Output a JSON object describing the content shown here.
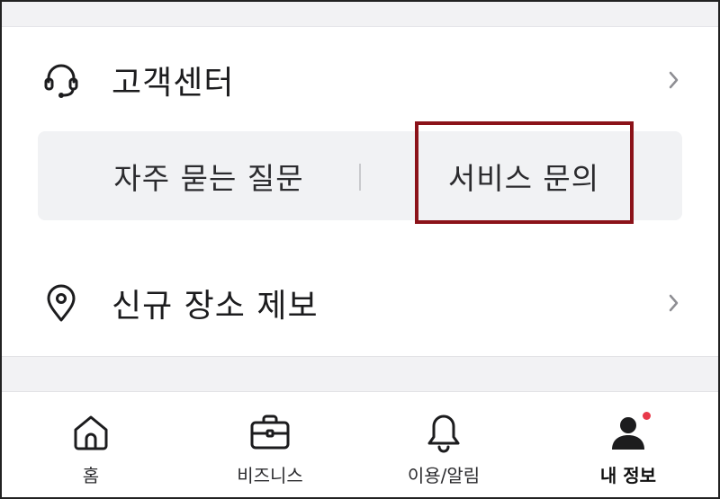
{
  "menu": {
    "support": {
      "label": "고객센터",
      "icon": "headset-icon"
    },
    "report": {
      "label": "신규 장소 제보",
      "icon": "location-pin-icon"
    }
  },
  "support_options": {
    "faq": "자주 묻는 질문",
    "inquiry": "서비스 문의",
    "highlighted": "inquiry"
  },
  "bottom_nav": {
    "items": [
      {
        "label": "홈",
        "icon": "home-icon"
      },
      {
        "label": "비즈니스",
        "icon": "briefcase-icon"
      },
      {
        "label": "이용/알림",
        "icon": "bell-icon"
      },
      {
        "label": "내 정보",
        "icon": "profile-icon",
        "active": true
      }
    ]
  },
  "colors": {
    "highlight_border": "#8b1219",
    "notification_dot": "#e8394a",
    "text_primary": "#1c1c1e",
    "segment_bg": "#f1f2f4"
  }
}
